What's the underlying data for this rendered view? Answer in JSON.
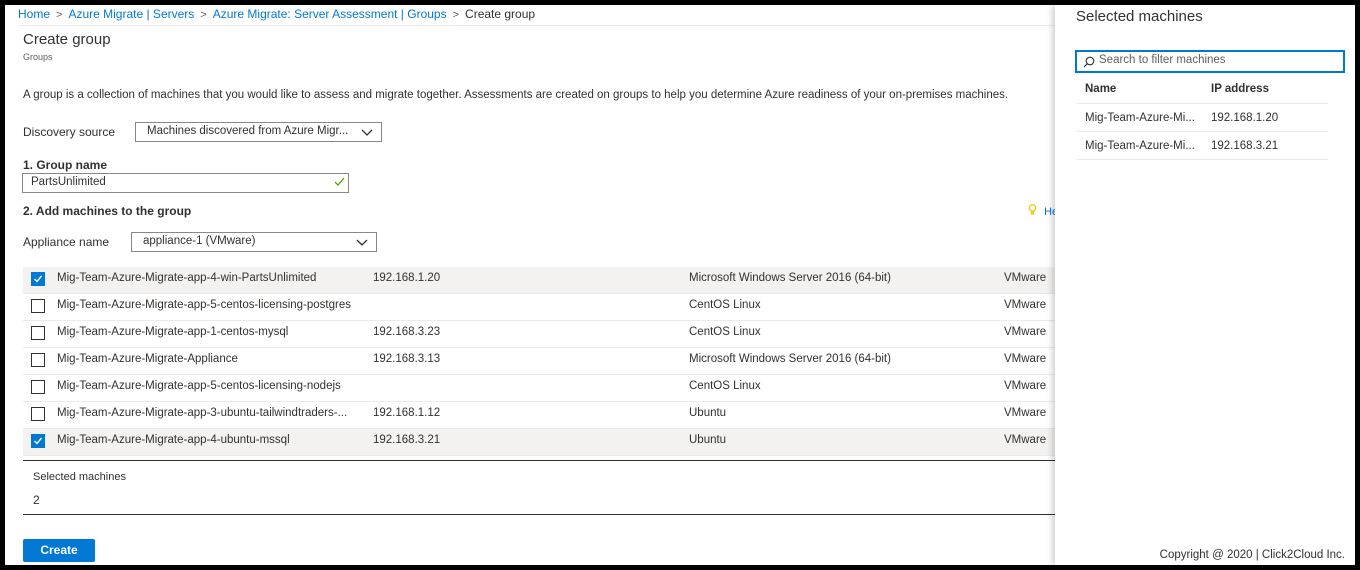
{
  "breadcrumb": {
    "items": [
      "Home",
      "Azure Migrate | Servers",
      "Azure Migrate: Server Assessment | Groups"
    ],
    "current": "Create group"
  },
  "page": {
    "title": "Create group",
    "subtitle": "Groups",
    "description": "A group is a collection of machines that you would like to assess and migrate together. Assessments are created on groups to help you determine Azure readiness of your on-premises machines."
  },
  "discovery": {
    "label": "Discovery source",
    "value": "Machines discovered from Azure Migr..."
  },
  "group_name": {
    "label": "1. Group name",
    "value": "PartsUnlimited"
  },
  "add_machines": {
    "label": "2. Add machines to the group",
    "hint": "He"
  },
  "appliance": {
    "label": "Appliance name",
    "value": "appliance-1 (VMware)"
  },
  "machines": [
    {
      "name": "Mig-Team-Azure-Migrate-app-4-win-PartsUnlimited",
      "ip": "192.168.1.20",
      "os": "Microsoft Windows Server 2016 (64-bit)",
      "source": "VMware",
      "checked": true
    },
    {
      "name": "Mig-Team-Azure-Migrate-app-5-centos-licensing-postgres",
      "ip": "",
      "os": "CentOS Linux",
      "source": "VMware",
      "checked": false
    },
    {
      "name": "Mig-Team-Azure-Migrate-app-1-centos-mysql",
      "ip": "192.168.3.23",
      "os": "CentOS Linux",
      "source": "VMware",
      "checked": false
    },
    {
      "name": "Mig-Team-Azure-Migrate-Appliance",
      "ip": "192.168.3.13",
      "os": "Microsoft Windows Server 2016 (64-bit)",
      "source": "VMware",
      "checked": false
    },
    {
      "name": "Mig-Team-Azure-Migrate-app-5-centos-licensing-nodejs",
      "ip": "",
      "os": "CentOS Linux",
      "source": "VMware",
      "checked": false
    },
    {
      "name": "Mig-Team-Azure-Migrate-app-3-ubuntu-tailwindtraders-...",
      "ip": "192.168.1.12",
      "os": "Ubuntu",
      "source": "VMware",
      "checked": false
    },
    {
      "name": "Mig-Team-Azure-Migrate-app-4-ubuntu-mssql",
      "ip": "192.168.3.21",
      "os": "Ubuntu",
      "source": "VMware",
      "checked": true
    }
  ],
  "selected_summary": {
    "label": "Selected machines",
    "count": "2"
  },
  "create_button": "Create",
  "panel": {
    "title": "Selected machines",
    "search_placeholder": "Search to filter machines",
    "columns": [
      "Name",
      "IP address"
    ],
    "rows": [
      {
        "name": "Mig-Team-Azure-Mi...",
        "ip": "192.168.1.20"
      },
      {
        "name": "Mig-Team-Azure-Mi...",
        "ip": "192.168.3.21"
      }
    ],
    "copyright": "Copyright @ 2020 |   Click2Cloud Inc."
  },
  "colors": {
    "accent": "#0078d4",
    "success_check": "#57a300",
    "hint_bulb": "#f2c811"
  }
}
